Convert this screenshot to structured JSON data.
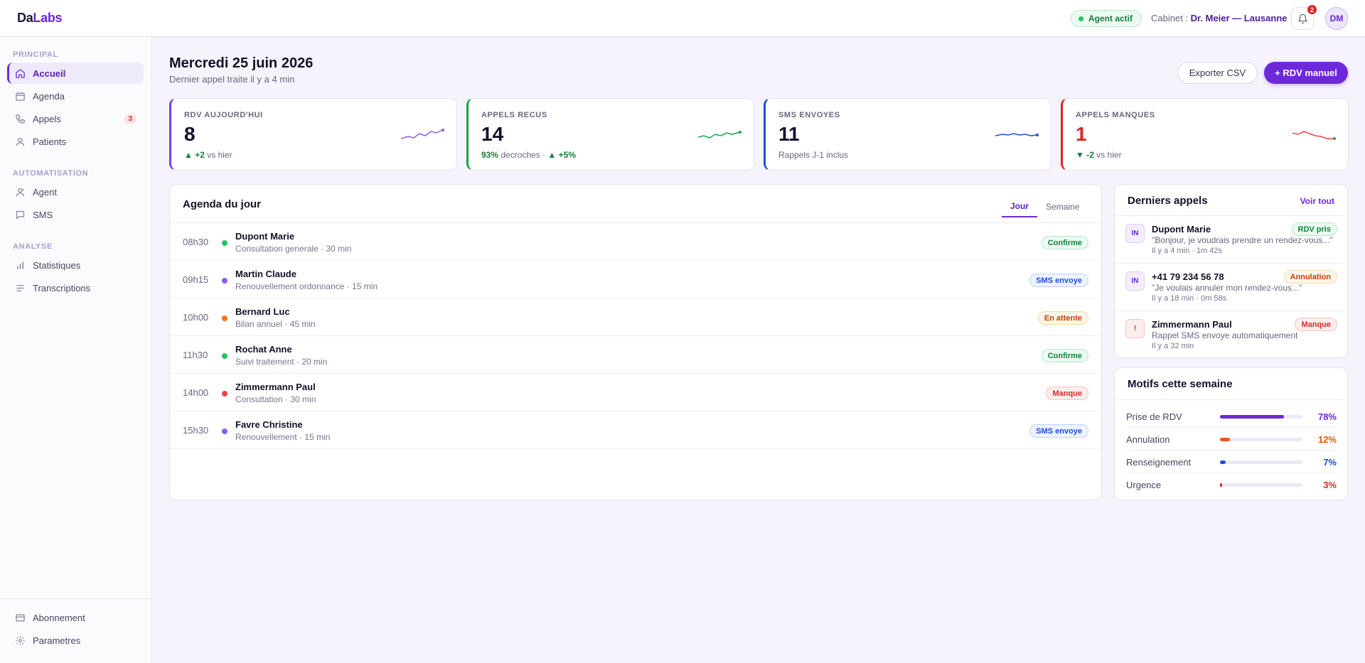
{
  "brand": {
    "part1": "Da",
    "part2": "Labs"
  },
  "topbar": {
    "agent_status": "Agent actif",
    "cabinet_label": "Cabinet :",
    "cabinet_name": "Dr. Meier — Lausanne",
    "notif_count": "2",
    "avatar_initials": "DM"
  },
  "sidebar": {
    "sections": [
      {
        "label": "Principal"
      },
      {
        "label": "Automatisation"
      },
      {
        "label": "Analyse"
      }
    ],
    "items": [
      {
        "label": "Accueil",
        "icon": "home-icon"
      },
      {
        "label": "Agenda",
        "icon": "calendar-icon"
      },
      {
        "label": "Appels",
        "icon": "phone-icon",
        "count": "3"
      },
      {
        "label": "Patients",
        "icon": "user-icon"
      },
      {
        "label": "Agent",
        "icon": "agent-icon"
      },
      {
        "label": "SMS",
        "icon": "message-icon"
      },
      {
        "label": "Statistiques",
        "icon": "chart-icon"
      },
      {
        "label": "Transcriptions",
        "icon": "text-icon"
      }
    ],
    "bottom": [
      {
        "label": "Abonnement",
        "icon": "card-icon"
      },
      {
        "label": "Parametres",
        "icon": "settings-icon"
      }
    ]
  },
  "header": {
    "title": "Mercredi 25 juin 2026",
    "subtitle": "Dernier appel traite il y a 4 min",
    "export_label": "Exporter CSV",
    "add_label": "+ RDV manuel"
  },
  "kpis": [
    {
      "label": "RDV AUJOURD'HUI",
      "value": "8",
      "delta": "+2",
      "delta_text": "vs hier",
      "color": "#7c3aed"
    },
    {
      "label": "APPELS RECUS",
      "value": "14",
      "rate": "93%",
      "rate_text": "decroches ·",
      "delta": "+5%",
      "color": "#16a34a"
    },
    {
      "label": "SMS ENVOYES",
      "value": "11",
      "foot": "Rappels J-1 inclus",
      "color": "#1d4ed8"
    },
    {
      "label": "APPELS MANQUES",
      "value": "1",
      "delta": "-2",
      "delta_text": "vs hier",
      "color": "#dc2626"
    }
  ],
  "agenda": {
    "title": "Agenda du jour",
    "tabs": [
      "Jour",
      "Semaine"
    ],
    "rows": [
      {
        "time": "08h30",
        "name": "Dupont Marie",
        "meta": "Consultation generale · 30 min",
        "status": "Confirme",
        "dot": "#22c55e"
      },
      {
        "time": "09h15",
        "name": "Martin Claude",
        "meta": "Renouvellement ordonnance · 15 min",
        "status": "SMS envoye",
        "dot": "#8b5cf6"
      },
      {
        "time": "10h00",
        "name": "Bernard Luc",
        "meta": "Bilan annuel · 45 min",
        "status": "En attente",
        "dot": "#f97316"
      },
      {
        "time": "11h30",
        "name": "Rochat Anne",
        "meta": "Suivi traitement · 20 min",
        "status": "Confirme",
        "dot": "#22c55e"
      },
      {
        "time": "14h00",
        "name": "Zimmermann Paul",
        "meta": "Consultation · 30 min",
        "status": "Manque",
        "dot": "#ef4444"
      },
      {
        "time": "15h30",
        "name": "Favre Christine",
        "meta": "Renouvellement · 15 min",
        "status": "SMS envoye",
        "dot": "#8b5cf6"
      }
    ]
  },
  "calls": {
    "title": "Derniers appels",
    "see_all": "Voir tout",
    "items": [
      {
        "badge": "IN",
        "name": "Dupont Marie",
        "desc": "\"Bonjour, je voudrais prendre un rendez-vous...\"",
        "time": "Il y a 4 min · 1m 42s",
        "status": "RDV pris"
      },
      {
        "badge": "IN",
        "name": "+41 79 234 56 78",
        "desc": "\"Je voulais annuler mon rendez-vous...\"",
        "time": "Il y a 18 min · 0m 58s",
        "status": "Annulation"
      },
      {
        "badge": "!",
        "name": "Zimmermann Paul",
        "desc": "Rappel SMS envoye automatiquement",
        "time": "Il y a 32 min",
        "status": "Manque"
      }
    ]
  },
  "motifs": {
    "title": "Motifs cette semaine",
    "items": [
      {
        "label": "Prise de RDV",
        "pct": "78%",
        "value": 78,
        "color": "#6d28d9"
      },
      {
        "label": "Annulation",
        "pct": "12%",
        "value": 12,
        "color": "#ea580c"
      },
      {
        "label": "Renseignement",
        "pct": "7%",
        "value": 7,
        "color": "#1d4ed8"
      },
      {
        "label": "Urgence",
        "pct": "3%",
        "value": 3,
        "color": "#dc2626"
      }
    ]
  }
}
